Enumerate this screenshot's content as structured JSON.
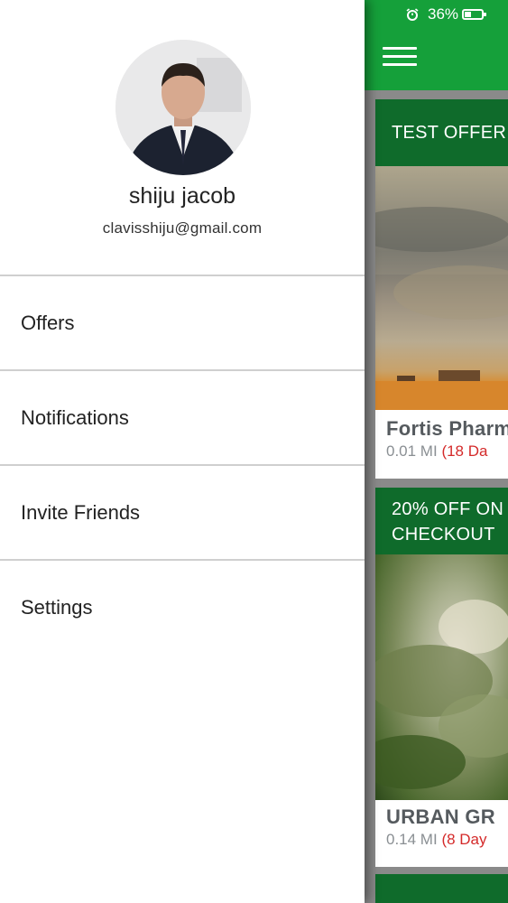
{
  "status_bar": {
    "battery_percent": "36%",
    "icons": [
      "alarm-icon",
      "battery-icon"
    ]
  },
  "drawer": {
    "user": {
      "name": "shiju jacob",
      "email": "clavisshiju@gmail.com"
    },
    "menu": [
      {
        "label": "Offers"
      },
      {
        "label": "Notifications"
      },
      {
        "label": "Invite Friends"
      },
      {
        "label": "Settings"
      }
    ]
  },
  "main": {
    "menu_icon": "hamburger-menu-icon",
    "cards": [
      {
        "header": "TEST OFFER",
        "title": "Fortis Pharm",
        "distance": "0.01 MI",
        "days": "(18 Da"
      },
      {
        "header": "20% OFF ON CHECKOUT",
        "header_line1": "20% OFF ON",
        "header_line2": "CHECKOUT",
        "title": "URBAN GR",
        "distance": "0.14 MI",
        "days": "(8 Day"
      }
    ]
  },
  "colors": {
    "brand_green": "#15a03a",
    "card_header_green": "#0f6b2b",
    "days_red": "#d42a2a"
  }
}
